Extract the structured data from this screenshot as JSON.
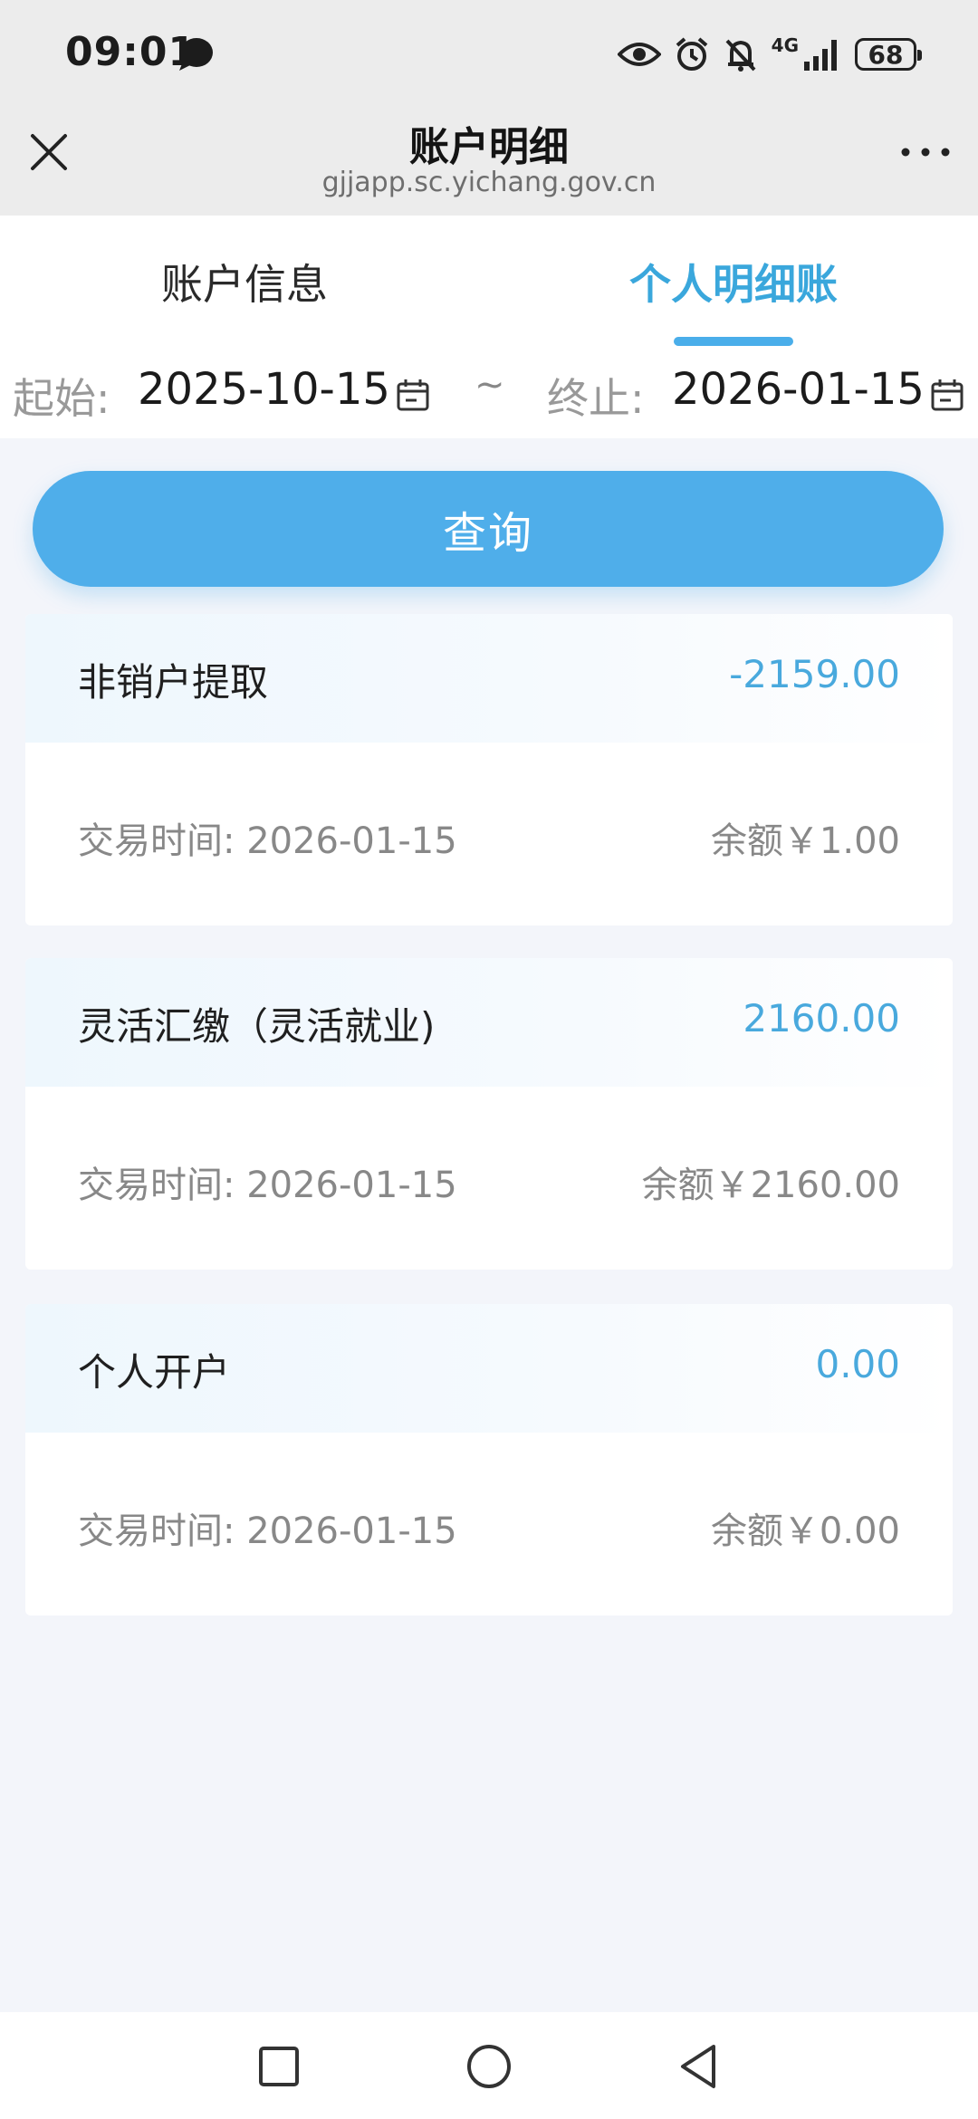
{
  "status_bar": {
    "time": "09:01",
    "network": "4G",
    "battery": "68",
    "icons": [
      "chat-bubble-icon",
      "eye-icon",
      "alarm-icon",
      "bell-off-icon",
      "signal-icon",
      "battery-icon"
    ]
  },
  "title_bar": {
    "title": "账户明细",
    "url": "gjjapp.sc.yichang.gov.cn",
    "icons": [
      "close-icon",
      "more-icon"
    ]
  },
  "tabs": [
    {
      "label": "账户信息",
      "active": false
    },
    {
      "label": "个人明细账",
      "active": true
    }
  ],
  "date_range": {
    "start_label": "起始:",
    "start_value": "2025-10-15",
    "separator": "~",
    "end_label": "终止:",
    "end_value": "2026-01-15"
  },
  "query_button": {
    "label": "查询"
  },
  "records": [
    {
      "type": "非销户提取",
      "amount": "-2159.00",
      "time": "交易时间: 2026-01-15",
      "balance": "余额￥1.00"
    },
    {
      "type": "灵活汇缴（灵活就业)",
      "amount": "2160.00",
      "time": "交易时间: 2026-01-15",
      "balance": "余额￥2160.00"
    },
    {
      "type": "个人开户",
      "amount": "0.00",
      "time": "交易时间: 2026-01-15",
      "balance": "余额￥0.00"
    }
  ],
  "nav_bar": {
    "icons": [
      "recent-apps-icon",
      "home-icon",
      "back-icon"
    ]
  },
  "colors": {
    "accent": "#4faeea",
    "amount": "#49a9dd",
    "background": "#f3f5fa"
  }
}
